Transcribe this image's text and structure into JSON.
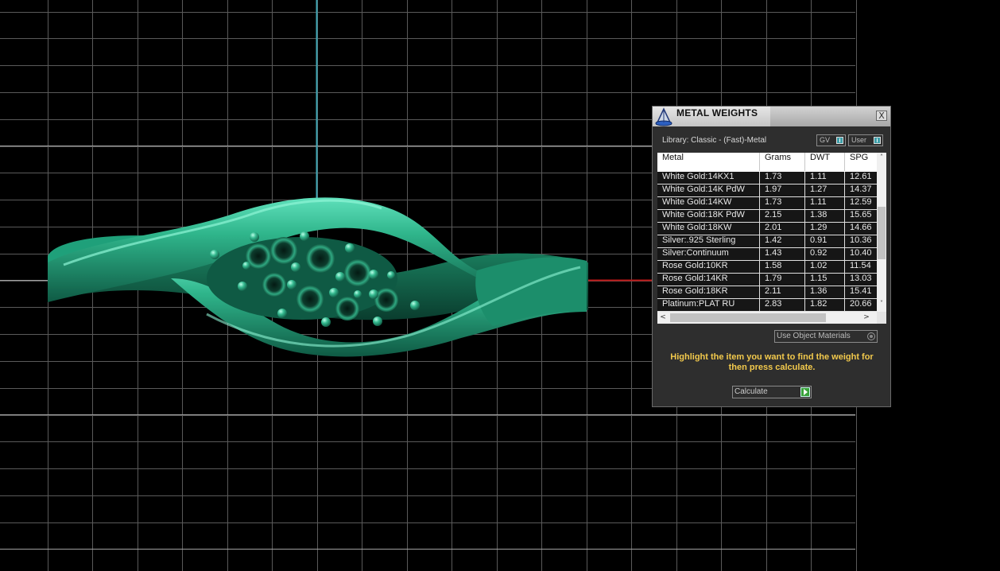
{
  "dialog": {
    "title": "METAL WEIGHTS",
    "close_glyph": "X",
    "library_label": "Library: Classic - (Fast)-Metal",
    "toggle_gv": "GV",
    "toggle_user": "User",
    "columns": [
      "Metal",
      "Grams",
      "DWT",
      "SPG"
    ],
    "rows": [
      [
        "White Gold:14KX1",
        "1.73",
        "1.11",
        "12.61"
      ],
      [
        "White Gold:14K PdW",
        "1.97",
        "1.27",
        "14.37"
      ],
      [
        "White Gold:14KW",
        "1.73",
        "1.11",
        "12.59"
      ],
      [
        "White Gold:18K PdW",
        "2.15",
        "1.38",
        "15.65"
      ],
      [
        "White Gold:18KW",
        "2.01",
        "1.29",
        "14.66"
      ],
      [
        "Silver:.925 Sterling",
        "1.42",
        "0.91",
        "10.36"
      ],
      [
        "Silver:Continuum",
        "1.43",
        "0.92",
        "10.40"
      ],
      [
        "Rose Gold:10KR",
        "1.58",
        "1.02",
        "11.54"
      ],
      [
        "Rose Gold:14KR",
        "1.79",
        "1.15",
        "13.03"
      ],
      [
        "Rose Gold:18KR",
        "2.11",
        "1.36",
        "15.41"
      ],
      [
        "Platinum:PLAT RU",
        "2.83",
        "1.82",
        "20.66"
      ]
    ],
    "scroll_up": "˄",
    "scroll_down": "˅",
    "scroll_left": "<",
    "scroll_right": ">",
    "use_object_materials": "Use Object Materials",
    "hint": "Highlight the item you want to find the weight for then press calculate.",
    "calculate_label": "Calculate"
  },
  "colors": {
    "viewport_bg": "#000000",
    "grid": "#6e6e6e",
    "axis_y": "#3fa7b5",
    "axis_x": "#c01818",
    "ring_metal": "#2fa881",
    "hint_text": "#f2c94c",
    "accent": "#3d9ea8"
  }
}
